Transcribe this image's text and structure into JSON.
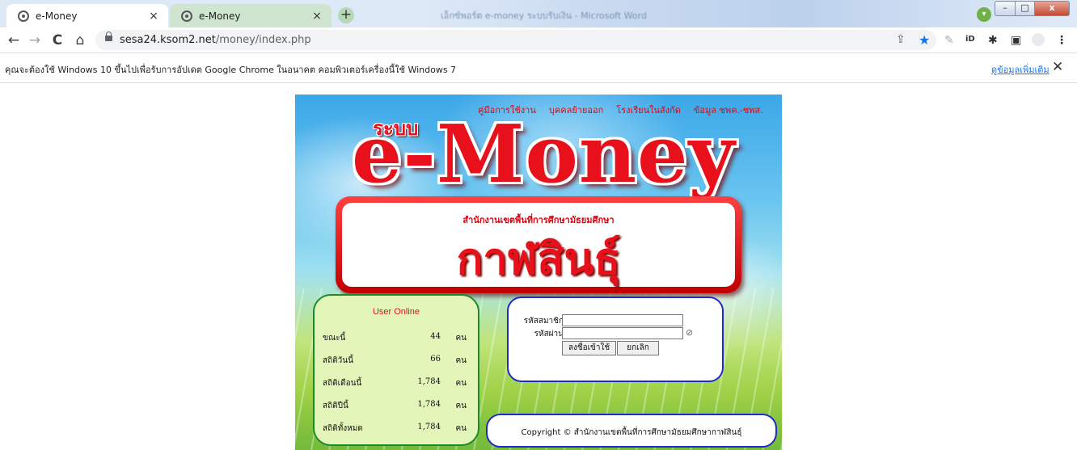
{
  "browser": {
    "tabs": [
      {
        "title": "e-Money",
        "close": "×"
      },
      {
        "title": "e-Money",
        "close": "×"
      }
    ],
    "new_tab": "+",
    "window_title": "เอ็กซ์พอร์ต e-money ระบบรับเงิน - Microsoft Word",
    "window_buttons": {
      "min": "–",
      "max": "□",
      "close": "x"
    },
    "nav": {
      "back": "←",
      "forward": "→",
      "reload": "C",
      "home": "⌂"
    },
    "url_host": "sesa24.ksom2.net",
    "url_path": "/money/index.php",
    "toolbar_icons": [
      "share-icon",
      "star-icon",
      "pin-icon",
      "id-extension-icon",
      "puzzle-icon",
      "sidepanel-icon",
      "profile-icon",
      "menu-icon"
    ]
  },
  "infobar": {
    "message": "คุณจะต้องใช้ Windows 10 ขึ้นไปเพื่อรับการอัปเดต Google Chrome ในอนาคต คอมพิวเตอร์เครื่องนี้ใช้ Windows 7",
    "link": "ดูข้อมูลเพิ่มเติม",
    "close": "✕"
  },
  "page": {
    "top_links": [
      "คู่มือการใช้งาน",
      "บุคคลย้ายออก",
      "โรงเรียนในสังกัด",
      "ข้อมูล ชพค.-ชพส."
    ],
    "system_label": "ระบบ",
    "logo_text": "e-Money",
    "office_name": "สำนักงานเขตพื้นที่การศึกษามัธยมศึกษา",
    "province": "กาฬสินธุ์",
    "user_online": {
      "title": "User Online",
      "rows": [
        {
          "label": "ขณะนี้",
          "value": "44",
          "unit": "คน"
        },
        {
          "label": "สถิติวันนี้",
          "value": "66",
          "unit": "คน"
        },
        {
          "label": "สถิติเดือนนี้",
          "value": "1,784",
          "unit": "คน"
        },
        {
          "label": "สถิติปีนี้",
          "value": "1,784",
          "unit": "คน"
        },
        {
          "label": "สถิติทั้งหมด",
          "value": "1,784",
          "unit": "คน"
        }
      ]
    },
    "login": {
      "username_label": "รหัสสมาชิก",
      "password_label": "รหัสผ่าน",
      "username_value": "",
      "password_value": "",
      "submit_label": "ลงชื่อเข้าใช้",
      "cancel_label": "ยกเลิก"
    },
    "copyright": "Copyright © สำนักงานเขตพื้นที่การศึกษามัธยมศึกษากาฬสินธุ์"
  }
}
